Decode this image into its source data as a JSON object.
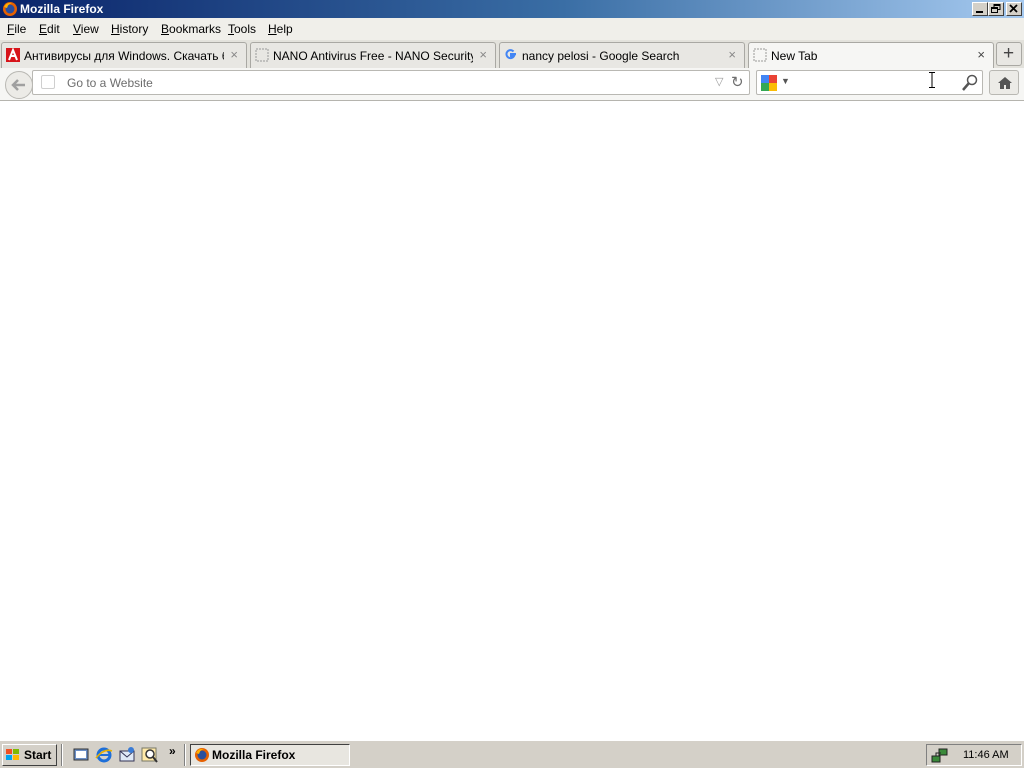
{
  "window": {
    "title": "Mozilla Firefox"
  },
  "menu": [
    {
      "accel": "F",
      "rest": "ile"
    },
    {
      "accel": "E",
      "rest": "dit"
    },
    {
      "accel": "V",
      "rest": "iew"
    },
    {
      "accel": "H",
      "rest": "istory"
    },
    {
      "accel": "B",
      "rest": "ookmarks"
    },
    {
      "accel": "T",
      "rest": "ools"
    },
    {
      "accel": "H",
      "rest": "elp"
    }
  ],
  "tabs": [
    {
      "label": "Антивирусы для Windows. Скачать бе..."
    },
    {
      "label": "NANO Antivirus Free - NANO Security Ltd."
    },
    {
      "label": "nancy pelosi - Google Search"
    },
    {
      "label": "New Tab"
    }
  ],
  "tab_close_glyph": "×",
  "newtab_glyph": "+",
  "urlbar": {
    "placeholder": "Go to a Website",
    "value": ""
  },
  "searchbar": {
    "value": ""
  },
  "taskbar": {
    "start_label": "Start",
    "quicklaunch_more": "»",
    "task_label": "Mozilla Firefox",
    "clock": "11:46 AM"
  },
  "colors": {
    "titlebar_start": "#0a246a",
    "titlebar_end": "#a6caf0",
    "chrome": "#f6f6f4",
    "taskbar": "#d4d0c8"
  }
}
